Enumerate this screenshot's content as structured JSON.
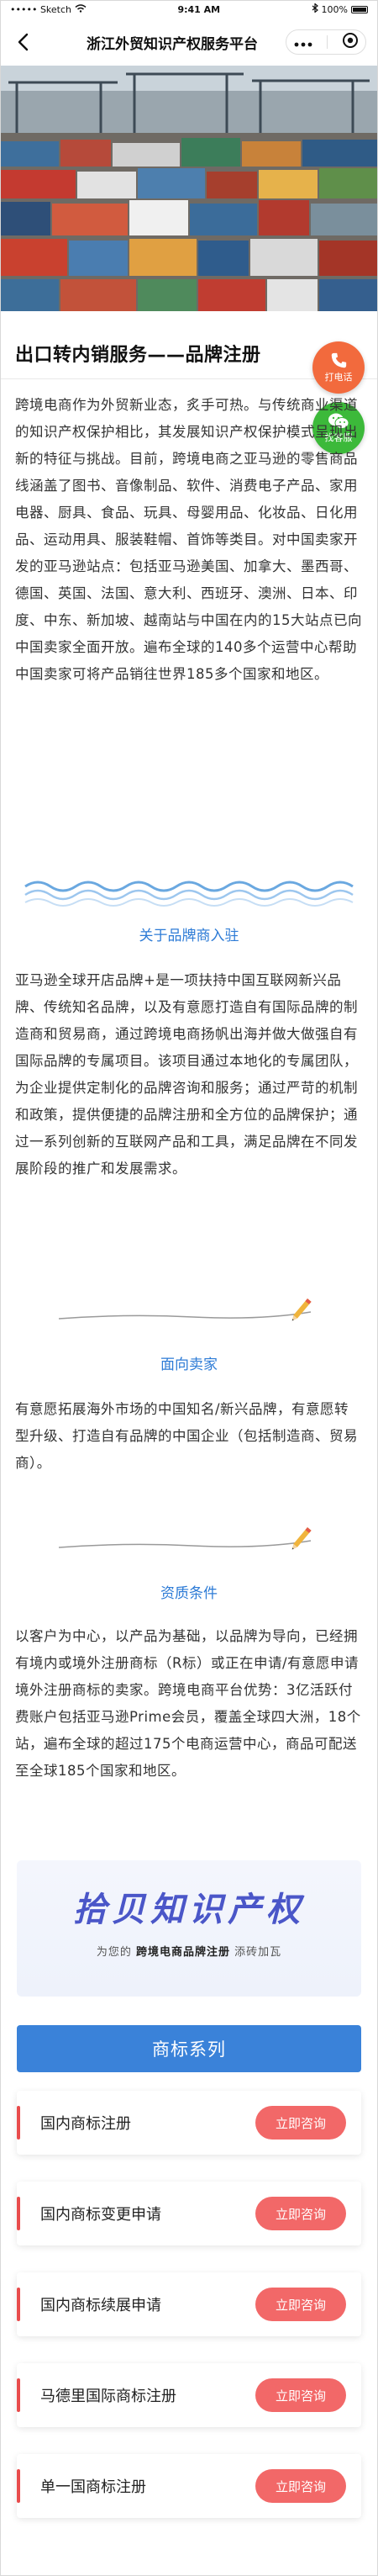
{
  "status_bar": {
    "carrier": "••••• Sketch",
    "time": "9:41 AM",
    "battery": "100%"
  },
  "nav": {
    "title": "浙江外贸知识产权服务平台",
    "more_icon": "more-dots-icon",
    "close_icon": "target-close-icon"
  },
  "hero": {
    "image": "container-port-photo"
  },
  "page_title": "出口转内销服务——品牌注册",
  "intro_paragraph": "跨境电商作为外贸新业态，炙手可热。与传统商业渠道的知识产权保护相比，其发展知识产权保护模式呈现出新的特征与挑战。目前，跨境电商之亚马逊的零售商品线涵盖了图书、音像制品、软件、消费电子产品、家用电器、厨具、食品、玩具、母婴用品、化妆品、日化用品、运动用具、服装鞋帽、首饰等类目。对中国卖家开发的亚马逊站点：包括亚马逊美国、加拿大、墨西哥、德国、英国、法国、意大利、西班牙、澳洲、日本、印度、中东、新加坡、越南站与中国在内的15大站点已向中国卖家全面开放。遍布全球的140多个运营中心帮助中国卖家可将产品销往世界185多个国家和地区。",
  "float_buttons": {
    "call_label": "打电话",
    "wechat_label": "找客服"
  },
  "sections": [
    {
      "heading": "关于品牌商入驻",
      "body": "亚马逊全球开店品牌+是一项扶持中国互联网新兴品牌、传统知名品牌，以及有意愿打造自有国际品牌的制造商和贸易商，通过跨境电商扬帆出海并做大做强自有国际品牌的专属项目。该项目通过本地化的专属团队，为企业提供定制化的品牌咨询和服务；通过严苛的机制和政策，提供便捷的品牌注册和全方位的品牌保护；通过一系列创新的互联网产品和工具，满足品牌在不同发展阶段的推广和发展需求。"
    },
    {
      "heading": "面向卖家",
      "body": "有意愿拓展海外市场的中国知名/新兴品牌，有意愿转型升级、打造自有品牌的中国企业（包括制造商、贸易商）。"
    },
    {
      "heading": "资质条件",
      "body": "以客户为中心，以产品为基础，以品牌为导向，已经拥有境内或境外注册商标（R标）或正在申请/有意愿申请境外注册商标的卖家。跨境电商平台优势：3亿活跃付费账户包括亚马逊Prime会员，覆盖全球四大洲，18个站，遍布全球的超过175个电商运营中心，商品可配送至全球185个国家和地区。"
    }
  ],
  "brand": {
    "logo_text": "拾贝知识产权",
    "tagline_prefix": "为您的",
    "tagline_bold": "跨境电商品牌注册",
    "tagline_suffix": "添砖加瓦"
  },
  "series_title": "商标系列",
  "services": [
    {
      "name": "国内商标注册",
      "button": "立即咨询"
    },
    {
      "name": "国内商标变更申请",
      "button": "立即咨询"
    },
    {
      "name": "国内商标续展申请",
      "button": "立即咨询"
    },
    {
      "name": "马德里国际商标注册",
      "button": "立即咨询"
    },
    {
      "name": "单一国商标注册",
      "button": "立即咨询"
    }
  ],
  "colors": {
    "accent_blue": "#3a82d9",
    "consult_red": "#f26868",
    "call_orange": "#f26a3d",
    "wechat_green": "#3cb93a",
    "brand_indigo": "#4a56c8"
  }
}
